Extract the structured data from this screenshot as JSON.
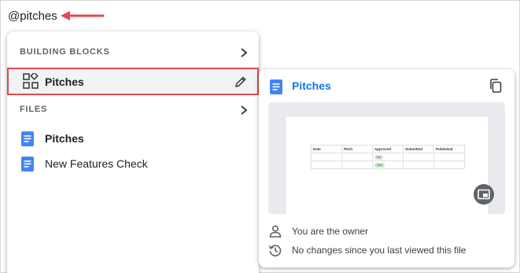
{
  "mention": {
    "text": "@pitches"
  },
  "colors": {
    "accent": "#1a73e8",
    "highlight_border": "#e5484d",
    "arrow": "#e5484d"
  },
  "dropdown": {
    "building_blocks": {
      "title": "BUILDING BLOCKS",
      "items": [
        {
          "label": "Pitches",
          "icon": "building-blocks-icon"
        }
      ]
    },
    "files": {
      "title": "FILES",
      "items": [
        {
          "label": "Pitches",
          "icon": "doc-icon"
        },
        {
          "label": "New Features Check",
          "icon": "doc-icon"
        }
      ]
    }
  },
  "preview": {
    "title": "Pitches",
    "thumbnail": {
      "columns": [
        "Date",
        "Pitch",
        "Approved",
        "Submitted",
        "Published"
      ],
      "chips": [
        "No",
        "Yes"
      ]
    },
    "info": [
      {
        "icon": "person-icon",
        "text": "You are the owner"
      },
      {
        "icon": "history-icon",
        "text": "No changes since you last viewed this file"
      }
    ]
  }
}
